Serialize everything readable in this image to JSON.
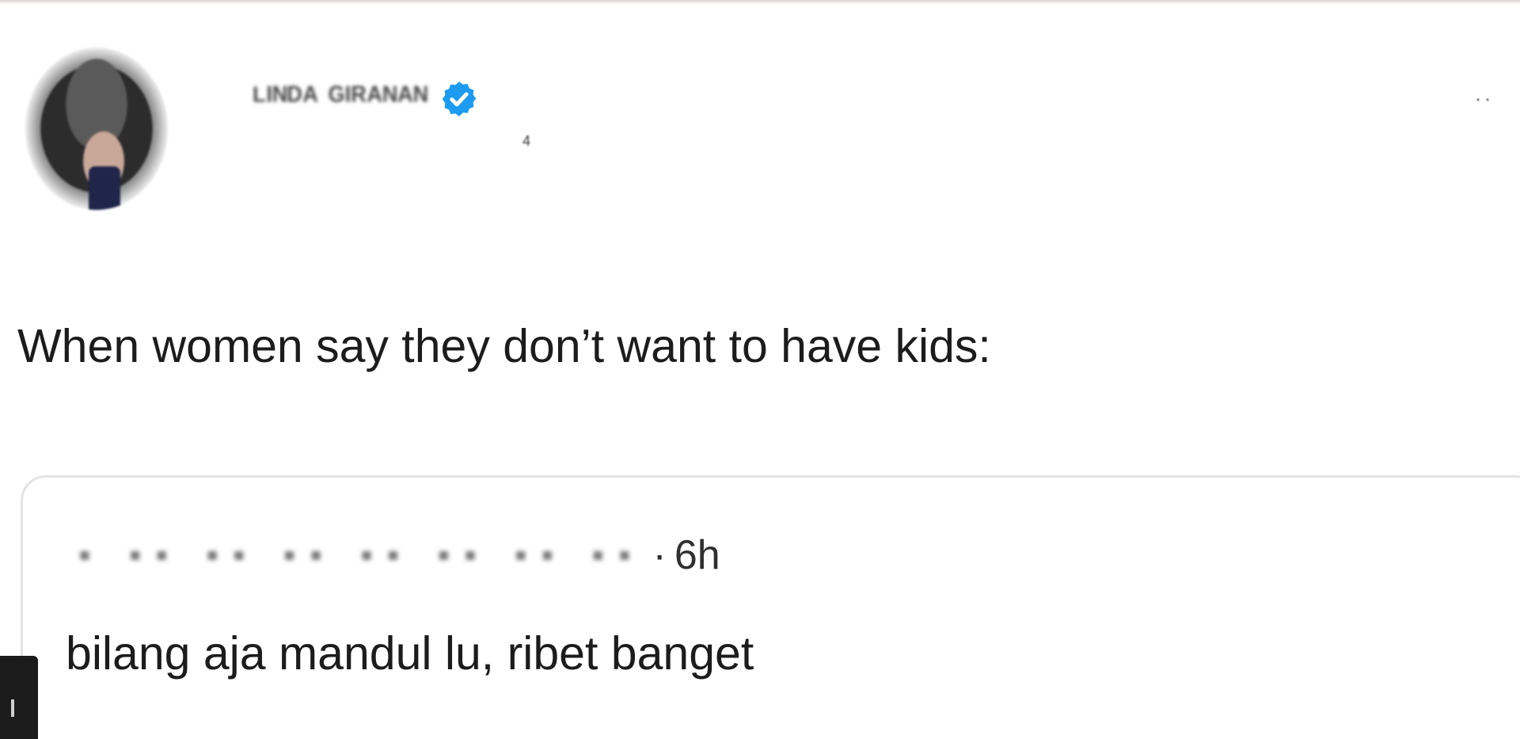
{
  "tweet": {
    "author_display_name": "ᴸᴵᴺᴰᴬ ᴳᴵᴿᴬᴺᴬᴺ",
    "handle_mark": "4",
    "verified": true,
    "text": "When women say they don’t want to have kids:",
    "more_icon": "more-horizontal-icon"
  },
  "quote": {
    "author_obscured": "▪︎ ▪︎▪︎ ▪︎▪︎ ▪︎▪︎ ▪︎▪︎ ▪︎▪︎ ▪︎▪︎ ▪︎▪︎",
    "separator": "·",
    "time": "6h",
    "text": "bilang aja mandul lu, ribet banget"
  },
  "colors": {
    "verified_blue": "#1d9bf0",
    "card_border": "#e3e3e3",
    "text": "#1c1c1c"
  }
}
